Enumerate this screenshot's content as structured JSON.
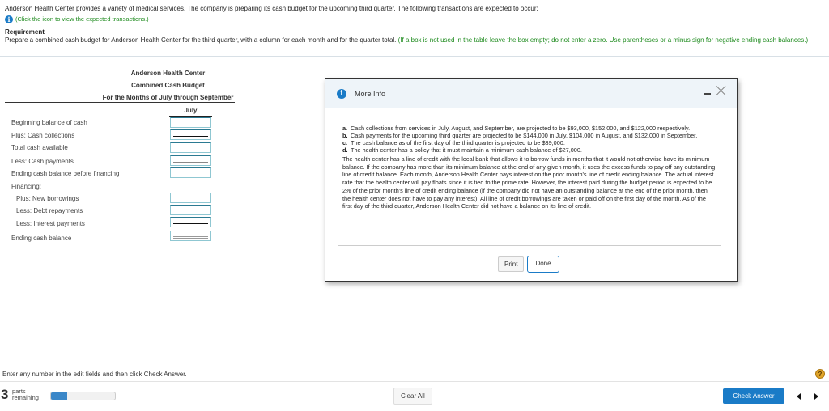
{
  "intro": {
    "problem_text": "Anderson Health Center provides a variety of medical services. The company is preparing its cash budget for the upcoming third quarter. The following transactions are expected to occur:",
    "hint_text": "(Click the icon to view the expected transactions.)",
    "requirement_title": "Requirement",
    "requirement_text": "Prepare a combined cash budget for Anderson Health Center for the third quarter, with a column for each month and for the quarter total.",
    "requirement_note": "(If a box is not used in the table leave the box empty; do not enter a zero. Use parentheses or a minus sign for negative ending cash balances.)"
  },
  "budget": {
    "company": "Anderson Health Center",
    "title": "Combined Cash Budget",
    "period": "For the Months of July through September",
    "column": "July",
    "rows": [
      {
        "label": "Beginning balance of cash",
        "value": ""
      },
      {
        "label": "Plus: Cash collections",
        "value": ""
      },
      {
        "label": "Total cash available",
        "value": ""
      },
      {
        "label": "Less: Cash payments",
        "value": ""
      },
      {
        "label": "Ending cash balance before financing",
        "value": ""
      },
      {
        "label": "Financing:"
      },
      {
        "label": "Plus: New borrowings",
        "value": ""
      },
      {
        "label": "Less: Debt repayments",
        "value": ""
      },
      {
        "label": "Less: Interest payments",
        "value": ""
      },
      {
        "label": "Ending cash balance",
        "value": ""
      }
    ]
  },
  "modal": {
    "title": "More Info",
    "items": [
      {
        "letter": "a.",
        "text": "Cash collections from services in July, August, and September, are projected to be $93,000, $152,000, and $122,000 respectively."
      },
      {
        "letter": "b.",
        "text": "Cash payments for the upcoming third quarter are projected to be $144,000 in July, $104,000 in August, and $132,000 in September."
      },
      {
        "letter": "c.",
        "text": "The cash balance as of the first day of the third quarter is projected to be $39,000."
      },
      {
        "letter": "d.",
        "text": "The health center has a policy that it must maintain a minimum cash balance of $27,000."
      }
    ],
    "paragraph": "The health center has a line of credit with the local bank that allows it to borrow funds in months that it would not otherwise have its minimum balance. If the company has more than its minimum balance at the end of any given month, it uses the excess funds to pay off any outstanding line of credit balance. Each month, Anderson Health Center pays interest on the prior month's line of credit ending balance. The actual interest rate that the health center will pay floats since it is tied to the prime rate. However, the interest paid during the budget period is expected to be 2% of the prior month's line of credit ending balance (if the company did not have an outstanding balance at the end of the prior month, then the health center does not have to pay any interest). All line of credit borrowings are taken or paid off on the first day of the month. As of the first day of the third quarter, Anderson Health Center did not have a balance on its line of credit.",
    "print_label": "Print",
    "done_label": "Done"
  },
  "footer": {
    "message": "Enter any number in the edit fields and then click Check Answer.",
    "parts_count": "3",
    "parts_label_1": "parts",
    "parts_label_2": "remaining",
    "progress_fraction": 0.25,
    "clear_label": "Clear All",
    "check_label": "Check Answer",
    "help_glyph": "?"
  },
  "colors": {
    "accent": "#1a7bc7",
    "hint_green": "#1c8a1c",
    "progress": "#3a87c8"
  }
}
